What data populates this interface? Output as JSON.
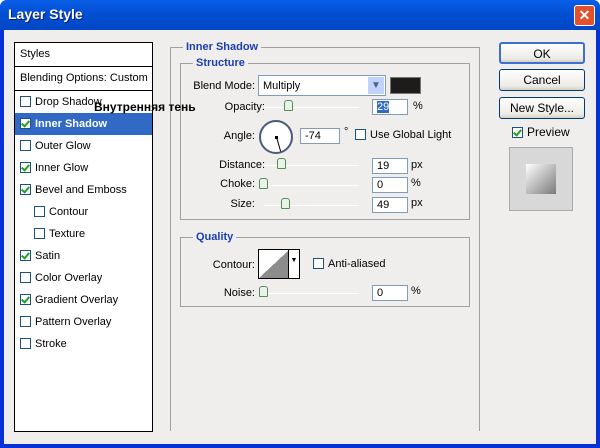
{
  "window": {
    "title": "Layer Style",
    "close": "✕"
  },
  "sidebar": {
    "header": "Styles",
    "blending": "Blending Options: Custom",
    "items": [
      {
        "label": "Drop Shadow",
        "checked": false,
        "indent": false
      },
      {
        "label": "Inner Shadow",
        "checked": true,
        "indent": false,
        "selected": true
      },
      {
        "label": "Outer Glow",
        "checked": false,
        "indent": false
      },
      {
        "label": "Inner Glow",
        "checked": true,
        "indent": false
      },
      {
        "label": "Bevel and Emboss",
        "checked": true,
        "indent": false
      },
      {
        "label": "Contour",
        "checked": false,
        "indent": true
      },
      {
        "label": "Texture",
        "checked": false,
        "indent": true
      },
      {
        "label": "Satin",
        "checked": true,
        "indent": false
      },
      {
        "label": "Color Overlay",
        "checked": false,
        "indent": false
      },
      {
        "label": "Gradient Overlay",
        "checked": true,
        "indent": false
      },
      {
        "label": "Pattern Overlay",
        "checked": false,
        "indent": false
      },
      {
        "label": "Stroke",
        "checked": false,
        "indent": false
      }
    ]
  },
  "overlay_text": "Внутренняя тень",
  "panel": {
    "title": "Inner Shadow",
    "structure": {
      "title": "Structure",
      "blend_mode_label": "Blend Mode:",
      "blend_mode": "Multiply",
      "color": "#1e1c1a",
      "opacity_label": "Opacity:",
      "opacity": "29",
      "opacity_unit": "%",
      "angle_label": "Angle:",
      "angle": "-74",
      "angle_unit": "°",
      "global_light": "Use Global Light",
      "distance_label": "Distance:",
      "distance": "19",
      "distance_unit": "px",
      "choke_label": "Choke:",
      "choke": "0",
      "choke_unit": "%",
      "size_label": "Size:",
      "size": "49",
      "size_unit": "px"
    },
    "quality": {
      "title": "Quality",
      "contour_label": "Contour:",
      "anti_aliased": "Anti-aliased",
      "noise_label": "Noise:",
      "noise": "0",
      "noise_unit": "%"
    }
  },
  "buttons": {
    "ok": "OK",
    "cancel": "Cancel",
    "new_style": "New Style...",
    "preview": "Preview"
  }
}
